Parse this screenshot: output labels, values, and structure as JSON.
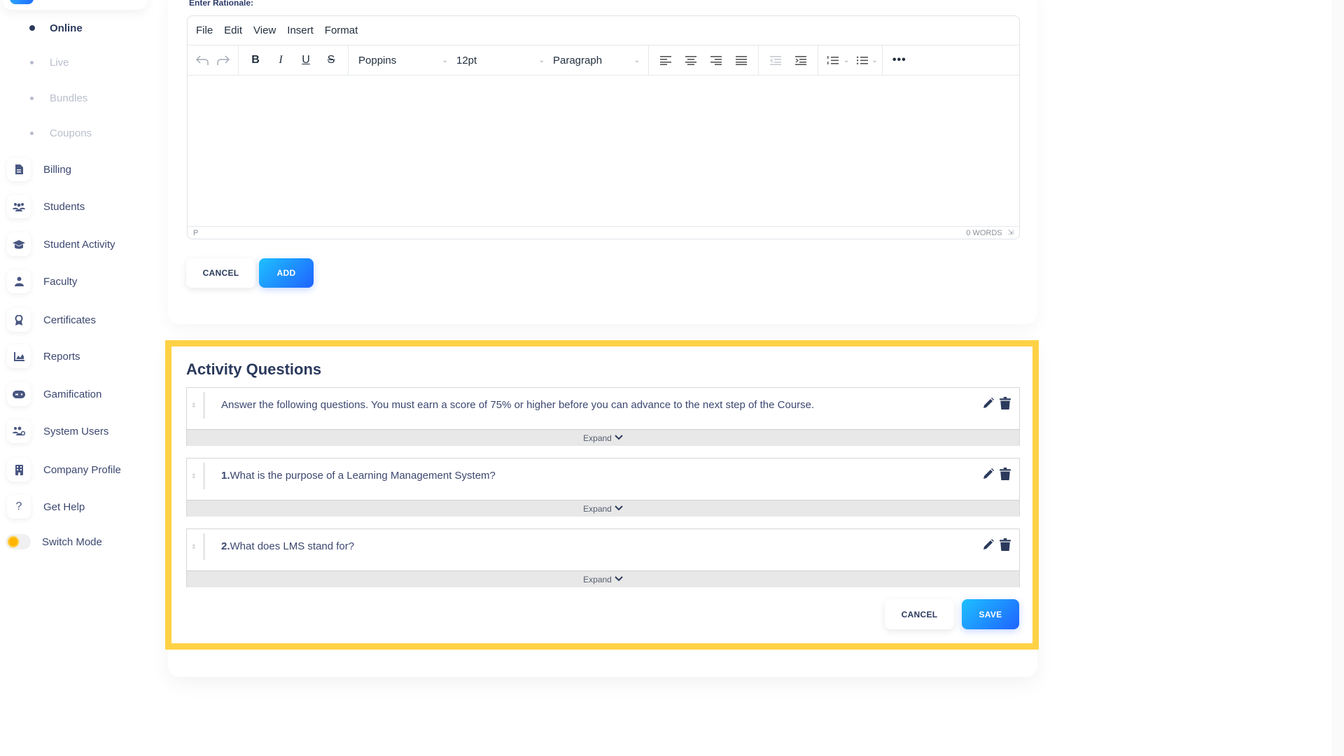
{
  "sidebar": {
    "sub_items": [
      {
        "label": "Online",
        "active": true
      },
      {
        "label": "Live",
        "active": false
      },
      {
        "label": "Bundles",
        "active": false
      },
      {
        "label": "Coupons",
        "active": false
      }
    ],
    "items": [
      {
        "label": "Billing",
        "icon": "file-invoice-icon"
      },
      {
        "label": "Students",
        "icon": "users-icon"
      },
      {
        "label": "Student Activity",
        "icon": "graduation-cap-icon"
      },
      {
        "label": "Faculty",
        "icon": "user-tie-icon"
      },
      {
        "label": "Certificates",
        "icon": "award-icon"
      },
      {
        "label": "Reports",
        "icon": "chart-area-icon"
      },
      {
        "label": "Gamification",
        "icon": "gamepad-icon"
      },
      {
        "label": "System Users",
        "icon": "users-cog-icon"
      },
      {
        "label": "Company Profile",
        "icon": "building-icon"
      },
      {
        "label": "Get Help",
        "icon": "question-icon"
      }
    ],
    "switch_mode_label": "Switch Mode"
  },
  "rationale": {
    "label": "Enter Rationale:",
    "menu": [
      "File",
      "Edit",
      "View",
      "Insert",
      "Format"
    ],
    "font_family": "Poppins",
    "font_size": "12pt",
    "block_format": "Paragraph",
    "status_path": "P",
    "word_count": "0 WORDS",
    "content": "",
    "cancel_label": "CANCEL",
    "add_label": "ADD"
  },
  "activity_questions": {
    "title": "Activity Questions",
    "questions": [
      {
        "number": "",
        "text": "Answer the following questions. You must earn a score of 75% or higher before you can advance to the next step of the Course."
      },
      {
        "number": "1.",
        "text": "What is the purpose of a Learning Management System?"
      },
      {
        "number": "2.",
        "text": "What does LMS stand for?"
      }
    ],
    "expand_label": "Expand",
    "cancel_label": "CANCEL",
    "save_label": "SAVE"
  },
  "colors": {
    "highlight": "#ffd145",
    "primary_start": "#1ec0ff",
    "primary_end": "#1f63ff",
    "text_dark": "#2b3a5c"
  }
}
